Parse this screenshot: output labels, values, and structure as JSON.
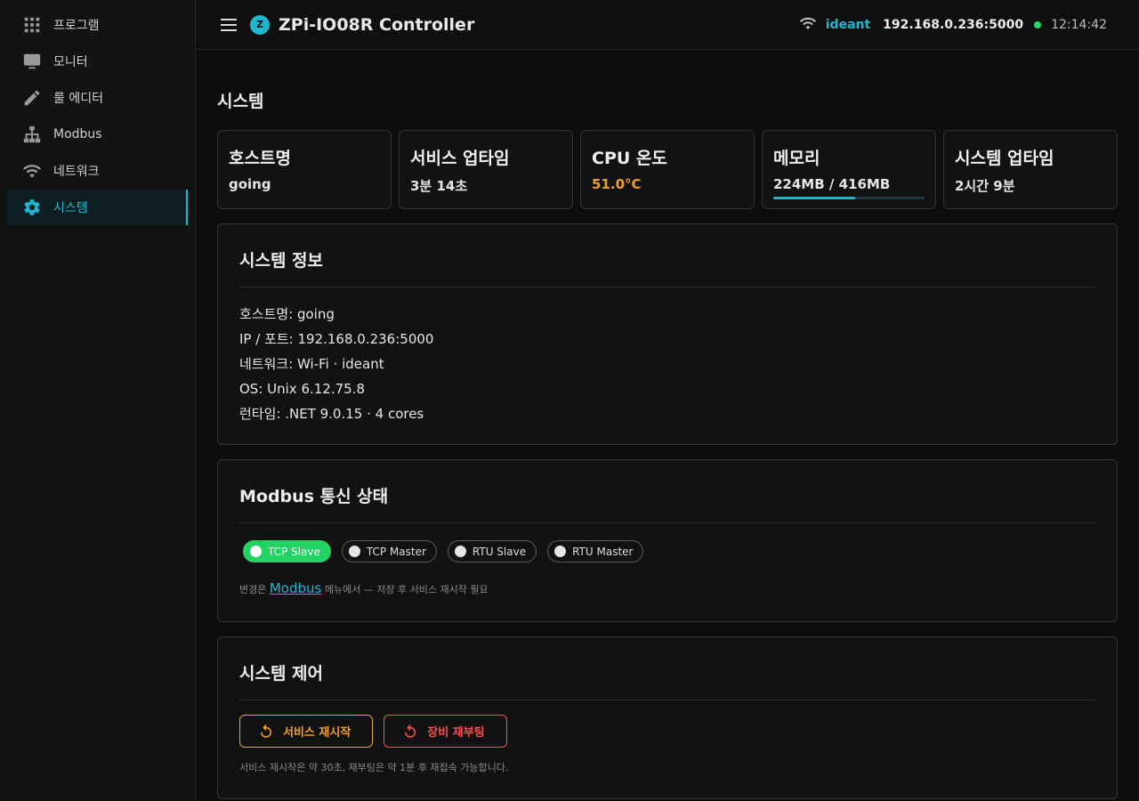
{
  "sidebar": {
    "items": [
      {
        "label": "프로그램",
        "icon": "grid-icon"
      },
      {
        "label": "모니터",
        "icon": "monitor-icon"
      },
      {
        "label": "룰 에디터",
        "icon": "pencil-icon"
      },
      {
        "label": "Modbus",
        "icon": "hierarchy-icon"
      },
      {
        "label": "네트워크",
        "icon": "wifi-icon"
      },
      {
        "label": "시스템",
        "icon": "gear-icon",
        "active": true
      }
    ]
  },
  "header": {
    "logo_letter": "Z",
    "title": "ZPi-IO08R Controller",
    "ssid": "ideant",
    "ip": "192.168.0.236:5000",
    "time": "12:14:42",
    "status_color": "#1fdc6a"
  },
  "page": {
    "title": "시스템"
  },
  "stats": [
    {
      "label": "호스트명",
      "value": "going"
    },
    {
      "label": "서비스 업타임",
      "value": "3분 14초"
    },
    {
      "label": "CPU 온도",
      "value": "51.0°C"
    },
    {
      "label": "메모리",
      "value": "224MB / 416MB",
      "usage_fraction": 0.54
    },
    {
      "label": "시스템 업타임",
      "value": "2시간 9분"
    }
  ],
  "system_info": {
    "title": "시스템 정보",
    "lines": [
      "호스트명: going",
      "IP / 포트: 192.168.0.236:5000",
      "네트워크: Wi-Fi · ideant",
      "OS: Unix 6.12.75.8",
      "런타임: .NET 9.0.15 · 4 cores"
    ]
  },
  "modbus": {
    "title": "Modbus 통신 상태",
    "chips": [
      {
        "label": "TCP Slave",
        "on": true
      },
      {
        "label": "TCP Master",
        "on": false
      },
      {
        "label": "RTU Slave",
        "on": false
      },
      {
        "label": "RTU Master",
        "on": false
      }
    ],
    "hint_prefix": "변경은 ",
    "hint_link": "Modbus",
    "hint_suffix": " 메뉴에서 — 저장 후 서비스 재시작 필요"
  },
  "control": {
    "title": "시스템 제어",
    "restart_label": "서비스 재시작",
    "reboot_label": "장비 재부팅",
    "note": "서비스 재시작은 약 30초, 재부팅은 약 1분 후 재접속 가능합니다."
  },
  "colors": {
    "accent": "#1fb6d0",
    "warning": "#f2a023",
    "danger": "#ff4f4f",
    "success": "#22d364"
  }
}
